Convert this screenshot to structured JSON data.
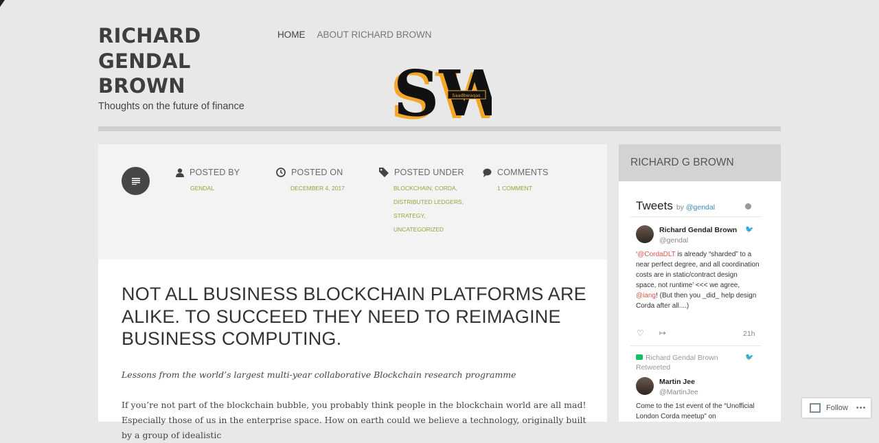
{
  "site": {
    "title_lines": [
      "RICHARD",
      "GENDAL",
      "BROWN"
    ],
    "tagline": "Thoughts on the future of finance"
  },
  "nav": {
    "home": "HOME",
    "about": "ABOUT RICHARD BROWN"
  },
  "logo": {
    "letters": "SW",
    "ribbon": "Saadbwaqas"
  },
  "post_meta": {
    "posted_by": {
      "label": "POSTED BY",
      "values": [
        "GENDAL"
      ]
    },
    "posted_on": {
      "label": "POSTED ON",
      "values": [
        "DECEMBER 4, 2017"
      ]
    },
    "posted_under": {
      "label": "POSTED UNDER",
      "values": [
        "BLOCKCHAIN, CORDA,",
        "DISTRIBUTED LEDGERS,",
        "STRATEGY,",
        "UNCATEGORIZED"
      ]
    },
    "comments": {
      "label": "COMMENTS",
      "values": [
        "1 COMMENT"
      ]
    }
  },
  "post": {
    "title": "NOT ALL BUSINESS BLOCKCHAIN PLATFORMS ARE ALIKE. TO SUCCEED THEY NEED TO REIMAGINE BUSINESS COMPUTING.",
    "lede": "Lessons from the world’s largest multi-year collaborative Blockchain research programme",
    "paragraph": "If you’re not part of the blockchain bubble, you probably think people in the blockchain world are all mad! Especially those of us in the enterprise space. How on earth could we believe a technology, originally built by a group of idealistic"
  },
  "sidebar": {
    "heading": "RICHARD G BROWN",
    "tweets_title": "Tweets",
    "tweets_by": "by",
    "tweets_handle": "@gendal",
    "tweet1": {
      "name": "Richard Gendal Brown",
      "handle": "@gendal",
      "t1": "‘",
      "m1": "@CordaDLT",
      "t2": " is already “sharded” to a near perfect degree, and all coordination costs are in static/contract design space, not runtime’ <<< we agree, ",
      "m2": "@iang",
      "t3": "! (But then you _did_ help design Corda after all....)",
      "time": "21h"
    },
    "retweet_line1": "Richard Gendal Brown",
    "retweet_line2": "Retweeted",
    "tweet2": {
      "name": "Martin Jee",
      "handle": "@MartinJee",
      "text": "Come to the 1st event of the “Unofficial London Corda meetup” on"
    }
  },
  "follow": {
    "label": "Follow",
    "more": "•••"
  },
  "colors": {
    "accent_green": "#8da83b",
    "link_blue": "#3b88c3",
    "mention_red": "#e0554a",
    "logo_orange": "#f2a72a"
  }
}
